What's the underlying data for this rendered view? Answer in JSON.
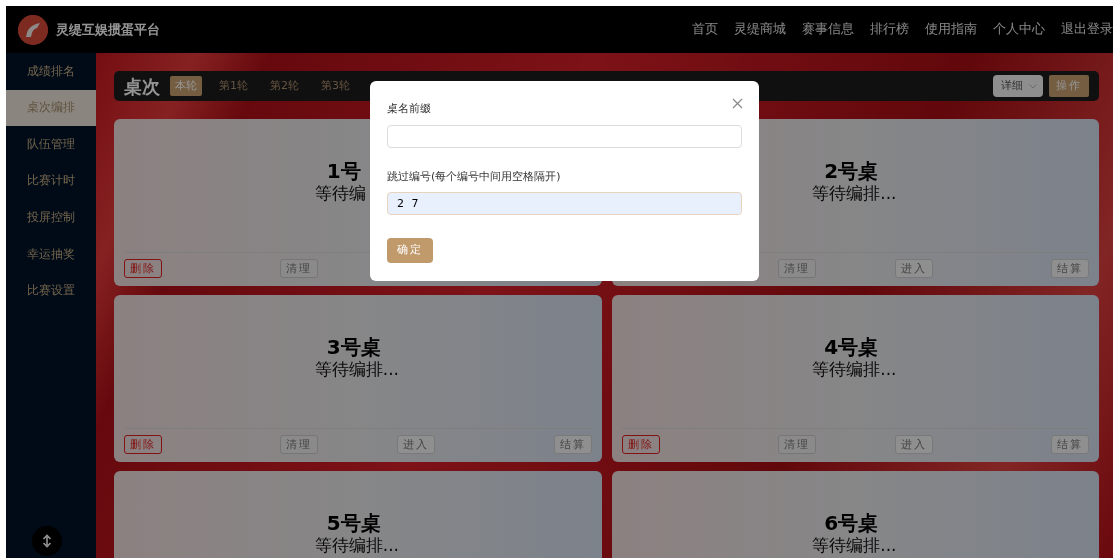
{
  "navbar": {
    "title": "灵缇互娱掼蛋平台",
    "links": [
      "首页",
      "灵缇商城",
      "赛事信息",
      "排行榜",
      "使用指南",
      "个人中心",
      "退出登录"
    ]
  },
  "sidebar": {
    "items": [
      {
        "label": "成绩排名",
        "selected": false
      },
      {
        "label": "桌次编排",
        "selected": true
      },
      {
        "label": "队伍管理",
        "selected": false
      },
      {
        "label": "比赛计时",
        "selected": false
      },
      {
        "label": "投屏控制",
        "selected": false
      },
      {
        "label": "幸运抽奖",
        "selected": false
      },
      {
        "label": "比赛设置",
        "selected": false
      }
    ]
  },
  "toolbar": {
    "title": "桌次",
    "tabs": [
      {
        "label": "本轮",
        "selected": true
      },
      {
        "label": "第1轮",
        "selected": false
      },
      {
        "label": "第2轮",
        "selected": false
      },
      {
        "label": "第3轮",
        "selected": false
      }
    ],
    "select": {
      "value": "详细"
    },
    "action_button": "操作"
  },
  "tables": [
    {
      "name": "1号",
      "status": "等待编",
      "buttons": [
        {
          "label": "删除",
          "kind": "danger"
        },
        {
          "label": "清理",
          "kind": "fill"
        }
      ]
    },
    {
      "name": "2号桌",
      "status": "等待编排...",
      "buttons": [
        {
          "label": "清理",
          "kind": "fill"
        },
        {
          "label": "进入",
          "kind": "outline"
        },
        {
          "label": "结算",
          "kind": "outline"
        }
      ]
    },
    {
      "name": "3号桌",
      "status": "等待编排...",
      "buttons": [
        {
          "label": "删除",
          "kind": "danger"
        },
        {
          "label": "清理",
          "kind": "fill"
        },
        {
          "label": "进入",
          "kind": "outline"
        },
        {
          "label": "结算",
          "kind": "outline"
        }
      ]
    },
    {
      "name": "4号桌",
      "status": "等待编排...",
      "buttons": [
        {
          "label": "删除",
          "kind": "danger"
        },
        {
          "label": "清理",
          "kind": "fill"
        },
        {
          "label": "进入",
          "kind": "outline"
        },
        {
          "label": "结算",
          "kind": "outline"
        }
      ]
    },
    {
      "name": "5号桌",
      "status": "等待编排..."
    },
    {
      "name": "6号桌",
      "status": "等待编排..."
    }
  ],
  "dialog": {
    "fields": [
      {
        "label": "桌名前缀",
        "focused": false
      },
      {
        "label": "跳过编号(每个编号中间用空格隔开)",
        "value": "2 7",
        "focused": true
      }
    ],
    "confirm_button": "确定"
  }
}
